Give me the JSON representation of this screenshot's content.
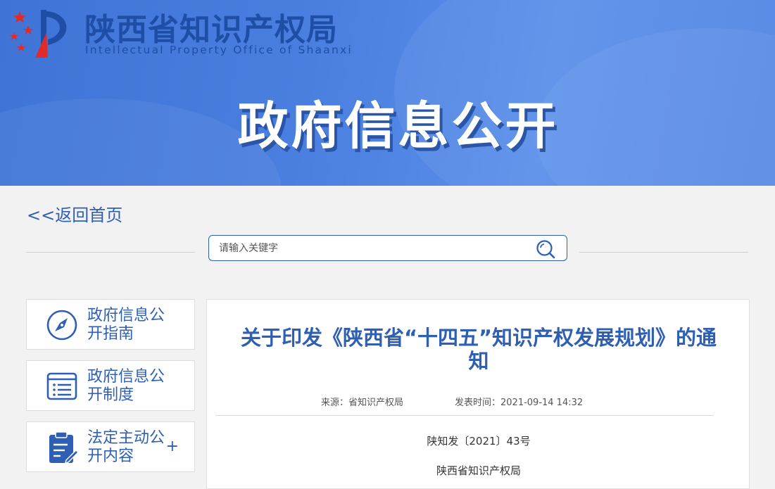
{
  "header": {
    "org_name_cn": "陕西省知识产权局",
    "org_name_en": "Intellectual Property Office of Shaanxi",
    "banner_title": "政府信息公开"
  },
  "nav": {
    "back_link": "<<返回首页"
  },
  "search": {
    "placeholder": "请输入关键字",
    "value": ""
  },
  "sidebar": {
    "items": [
      {
        "label": "政府信息公开指南",
        "icon": "compass-icon"
      },
      {
        "label": "政府信息公开制度",
        "icon": "document-list-icon"
      },
      {
        "label": "法定主动公开内容",
        "icon": "clipboard-edit-icon",
        "expand": "+"
      }
    ]
  },
  "article": {
    "title": "关于印发《陕西省“十四五”知识产权发展规划》的通知",
    "source": "来源：省知识产权局",
    "published": "发表时间：2021-09-14 14:32",
    "doc_number": "陕知发〔2021〕43号",
    "issuer": "陕西省知识产权局"
  },
  "colors": {
    "banner": "#4a7fe0",
    "accent": "#2f5fb3",
    "org_text": "#1f4ea6",
    "star_red": "#e02b2b"
  }
}
